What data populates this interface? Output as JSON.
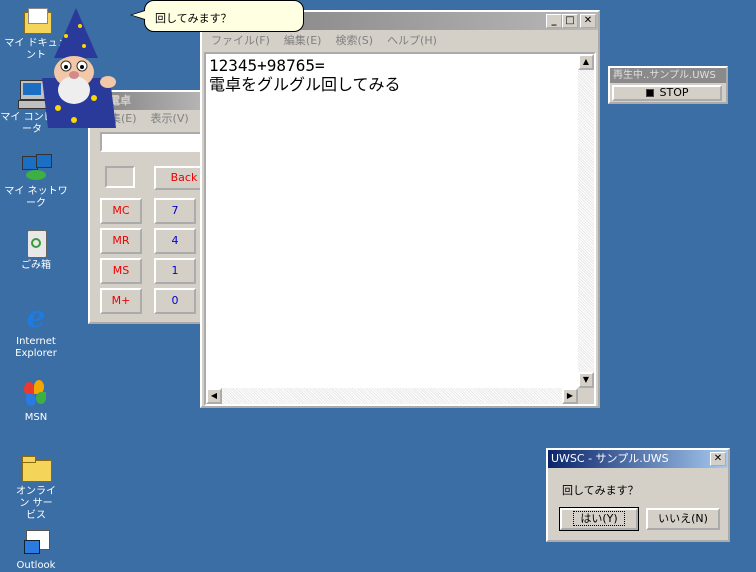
{
  "desktop": {
    "icons": [
      {
        "label": "マイ ドキュメント",
        "icon": "my-documents-icon"
      },
      {
        "label": "マイ コンピュータ",
        "icon": "my-computer-icon"
      },
      {
        "label": "マイ ネットワーク",
        "icon": "network-icon"
      },
      {
        "label": "ごみ箱",
        "icon": "recycle-bin-icon"
      },
      {
        "label": "Internet Explorer",
        "icon": "ie-icon"
      },
      {
        "label": "MSN",
        "icon": "msn-icon"
      },
      {
        "label": "オンライン サービス",
        "icon": "folder-icon"
      },
      {
        "label": "Outlook",
        "icon": "outlook-icon"
      }
    ],
    "background_color": "#3a6ea5"
  },
  "balloon": {
    "text": "回してみます？"
  },
  "notepad": {
    "menu": [
      "ファイル(F)",
      "編集(E)",
      "検索(S)",
      "ヘルプ(H)"
    ],
    "lines": [
      "12345+98765=",
      "電卓をグルグル回してみる"
    ]
  },
  "calculator": {
    "title": "電卓",
    "menu": [
      "編集(E)",
      "表示(V)"
    ],
    "back_label": "Back",
    "memory_buttons": [
      "MC",
      "MR",
      "MS",
      "M+"
    ],
    "digit_buttons": [
      "7",
      "4",
      "1",
      "0"
    ]
  },
  "player": {
    "title": "再生中..サンプル.UWS",
    "stop_label": "STOP"
  },
  "dialog": {
    "title": "UWSC - サンプル.UWS",
    "message": "回してみます？",
    "yes_label": "はい(Y)",
    "no_label": "いいえ(N)"
  }
}
